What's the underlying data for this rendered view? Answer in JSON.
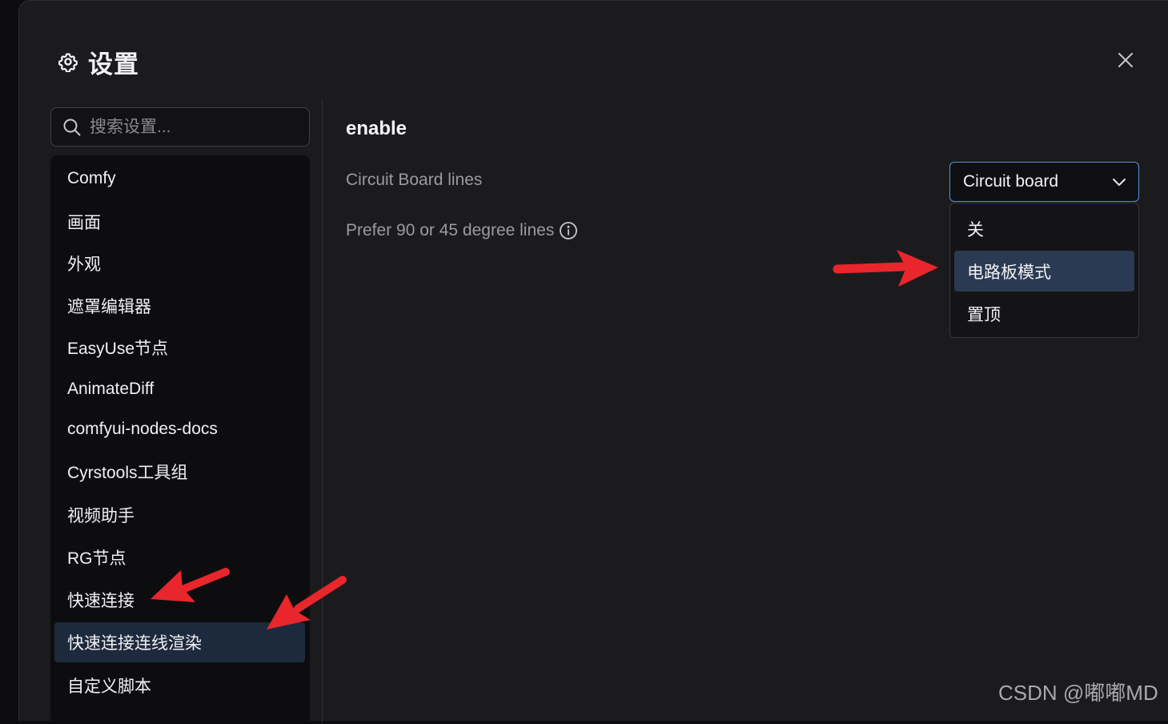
{
  "dialog": {
    "title": "设置",
    "gear_icon": "gear-icon",
    "close_icon": "close-icon"
  },
  "search": {
    "placeholder": "搜索设置..."
  },
  "sidebar": {
    "items": [
      {
        "label": "Comfy"
      },
      {
        "label": "画面"
      },
      {
        "label": "外观"
      },
      {
        "label": "遮罩编辑器"
      },
      {
        "label": "EasyUse节点"
      },
      {
        "label": "AnimateDiff"
      },
      {
        "label": "comfyui-nodes-docs"
      },
      {
        "label": "Cyrstools工具组"
      },
      {
        "label": "视频助手"
      },
      {
        "label": "RG节点"
      },
      {
        "label": "快速连接"
      },
      {
        "label": "快速连接连线渲染",
        "active": true
      },
      {
        "label": "自定义脚本"
      }
    ]
  },
  "main": {
    "section_title": "enable",
    "settings": [
      {
        "label": "Circuit Board lines"
      },
      {
        "label": "Prefer 90 or 45 degree lines",
        "info_icon": "info-icon"
      }
    ],
    "select": {
      "value": "Circuit board",
      "chevron_icon": "chevron-down-icon",
      "options": [
        {
          "label": "关"
        },
        {
          "label": "电路板模式",
          "highlighted": true
        },
        {
          "label": "置顶"
        }
      ]
    }
  },
  "annotations": {
    "arrow_color": "#e8262c"
  },
  "watermark": "CSDN @嘟嘟MD",
  "colors": {
    "background": "#1b1b1e",
    "sidebar": "#0d0d0f",
    "active_item": "#1d2a3d",
    "highlighted_option": "#2a3a52",
    "select_border": "#5b8fd9"
  }
}
